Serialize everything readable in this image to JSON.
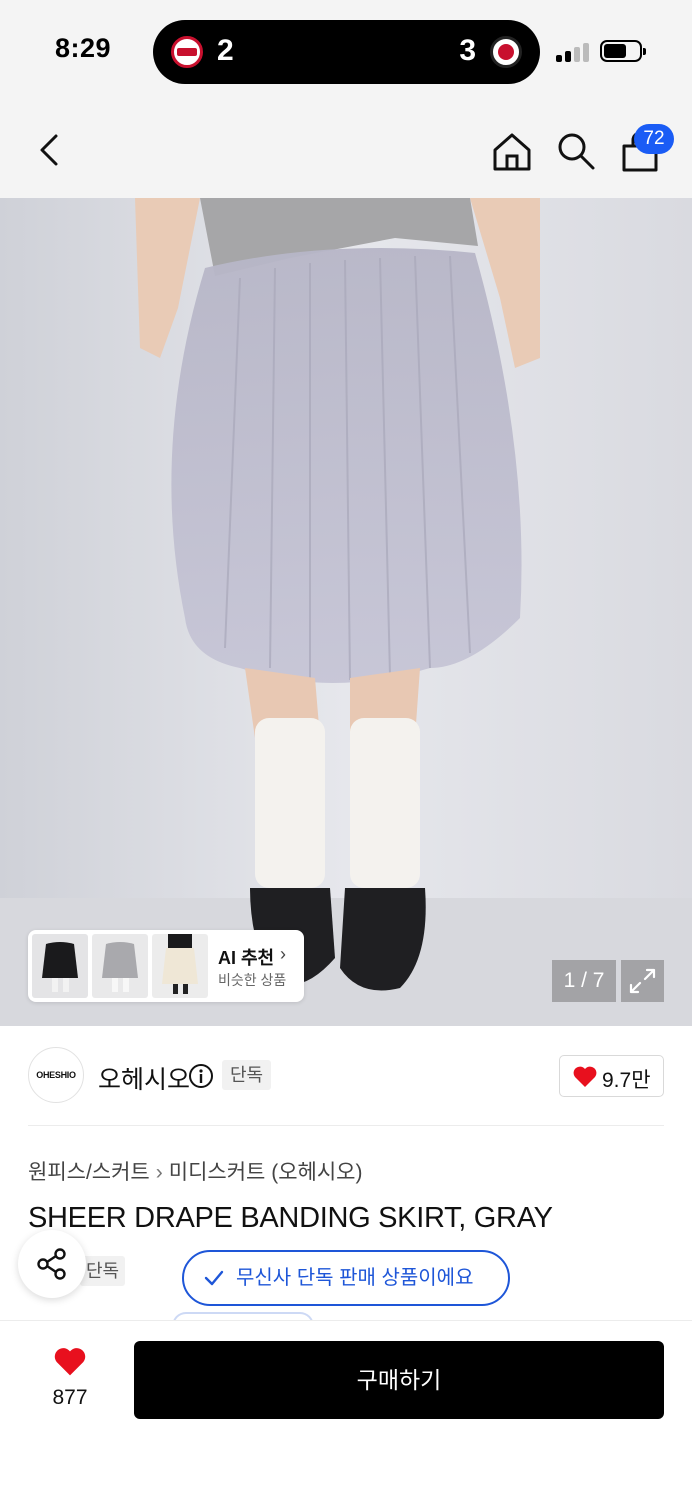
{
  "status_bar": {
    "time": "8:29",
    "live_activity": {
      "left_score": "2",
      "right_score": "3"
    }
  },
  "header": {
    "icons": [
      "back-arrow-icon",
      "home-icon",
      "search-icon",
      "cart-icon"
    ],
    "cart_badge": "72"
  },
  "gallery": {
    "page_counter": "1 / 7",
    "ai_recommend": {
      "title": "AI 추천",
      "chevron": "›",
      "subtitle": "비슷한 상품"
    }
  },
  "brand": {
    "logo_text": "OHESHIO",
    "name": "오헤시오",
    "exclusive_tag": "단독",
    "likes": "9.7만"
  },
  "product": {
    "breadcrumb": [
      "원피스/스커트",
      "미디스커트 (오헤시오)"
    ],
    "breadcrumb_sep": "›",
    "title": "SHEER DRAPE BANDING SKIRT, GRAY",
    "exclusive_tag": "단독"
  },
  "toast": {
    "message": "무신사 단독 판매 상품이에요"
  },
  "bottom_bar": {
    "like_count": "877",
    "buy_label": "구매하기"
  },
  "colors": {
    "accent_blue": "#1e56d8",
    "badge_blue": "#1a5cf5",
    "heart_red": "#e8101e",
    "buy_button": "#000000"
  }
}
